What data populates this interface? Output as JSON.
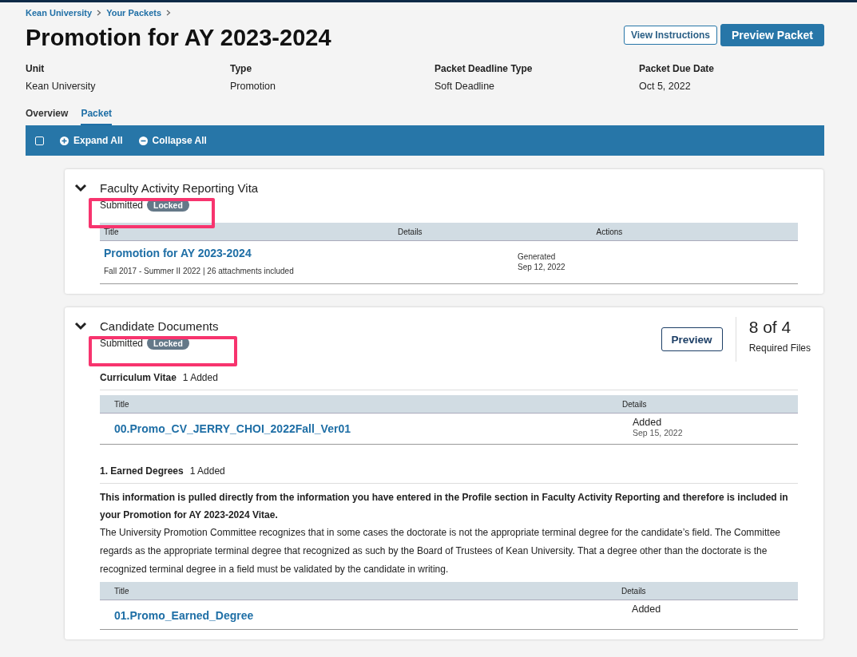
{
  "breadcrumb": [
    "Kean University",
    "Your Packets"
  ],
  "title": "Promotion for AY 2023-2024",
  "buttons": [
    {
      "label": "View Instructions",
      "kind": "outline"
    },
    {
      "label": "Preview Packet",
      "kind": "primary"
    }
  ],
  "meta": [
    {
      "label": "Unit",
      "value": "Kean University"
    },
    {
      "label": "Type",
      "value": "Promotion"
    },
    {
      "label": "Packet Deadline Type",
      "value": "Soft Deadline"
    },
    {
      "label": "Packet Due Date",
      "value": "Oct 5, 2022"
    }
  ],
  "tabs": [
    {
      "label": "Overview",
      "selected": false
    },
    {
      "label": "Packet",
      "selected": true
    }
  ],
  "toolbar": {
    "select_all_checked": false,
    "actions": [
      {
        "label": "Expand All",
        "kind": "expand"
      },
      {
        "label": "Collapse All",
        "kind": "collapse"
      }
    ]
  },
  "cards": [
    {
      "kind": "generated",
      "title": "Faculty Activity Reporting Vita",
      "expanded": true,
      "status": "Submitted",
      "badge": "Locked",
      "highlighted": true,
      "table": {
        "columns": [
          "Title",
          "Details",
          "Actions"
        ],
        "rows": [
          {
            "title": "Promotion for AY 2023-2024",
            "subtitle": "Fall 2017 - Summer II 2022 | 26 attachments included",
            "detail": "Generated",
            "date": "Sep 12, 2022"
          }
        ]
      }
    },
    {
      "kind": "documents",
      "title": "Candidate Documents",
      "expanded": true,
      "status": "Submitted",
      "badge": "Locked",
      "highlighted": true,
      "preview": "Preview",
      "count": "8 of 4",
      "count_label": "Required Files",
      "sections": [
        {
          "name": "Curriculum Vitae",
          "added": "1 Added",
          "columns": [
            "Title",
            "Details"
          ],
          "rows": [
            {
              "title": "00.Promo_CV_JERRY_CHOI_2022Fall_Ver01",
              "detail": "Added",
              "date": "Sep 15, 2022"
            }
          ]
        },
        {
          "name": "1. Earned Degrees",
          "added": "1 Added",
          "note_bold": "This information is pulled directly from the information you have entered in the Profile section in Faculty Activity Reporting and therefore is included in your Promotion for AY 2023-2024 Vitae.",
          "note": "The University Promotion Committee recognizes that in some cases the doctorate is not the appropriate terminal degree for the candidate’s field. The Committee regards as the appropriate terminal degree that recognized as such by the Board of Trustees of Kean University. That a degree other than the doctorate is the recognized terminal degree in a field must be validated by the candidate in writing.",
          "columns": [
            "Title",
            "Details"
          ],
          "rows": [
            {
              "title": "01.Promo_Earned_Degree",
              "detail": "Added"
            }
          ]
        }
      ]
    }
  ]
}
